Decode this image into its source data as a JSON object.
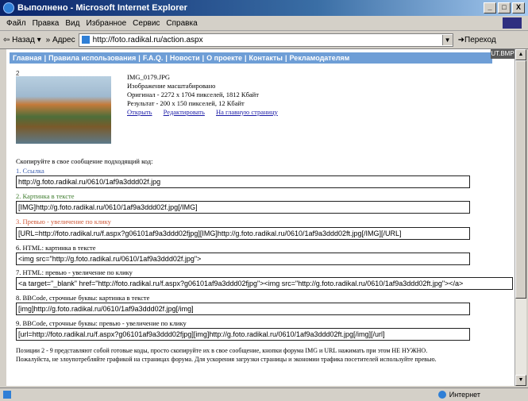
{
  "window": {
    "title": "Выполнено - Microsoft Internet Explorer",
    "minimize": "_",
    "maximize": "□",
    "close": "X"
  },
  "menu": {
    "items": [
      "Файл",
      "Правка",
      "Вид",
      "Избранное",
      "Сервис",
      "Справка"
    ]
  },
  "toolbar": {
    "back_label": "Назад",
    "address_label": "Адрес",
    "url": "http://foto.radikal.ru/action.aspx",
    "go_label": "Переход"
  },
  "nav": {
    "items": [
      "Главная",
      "Правила использования",
      "F.A.Q.",
      "Новости",
      "О проекте",
      "Контакты",
      "Рекламодателям"
    ],
    "separator": "|"
  },
  "image_info": {
    "marker": "2",
    "filename": "IMG_0179.JPG",
    "scaled_note": "Изображение масштабировано",
    "original": "Оригинал - 2272 x 1704 пикселей, 1812 Кбайт",
    "result": "Результат - 200 x 150 пикселей, 12 Кбайт",
    "links": [
      "Открыть",
      "Редактировать",
      "На главную страницу"
    ]
  },
  "copy_prompt": "Скопируйте в свое сообщение подходящий код:",
  "codes": [
    {
      "label": "1. Ссылка",
      "value": "http://g.foto.radikal.ru/0610/1af9a3ddd02f.jpg"
    },
    {
      "label": "2. Картинка в тексте",
      "value": "[IMG]http://g.foto.radikal.ru/0610/1af9a3ddd02f.jpg[/IMG]"
    },
    {
      "label": "3. Превью - увеличение по клику",
      "value": "[URL=http://foto.radikal.ru/f.aspx?g06101af9a3ddd02fjpg][IMG]http://g.foto.radikal.ru/0610/1af9a3ddd02ft.jpg[/IMG][/URL]"
    },
    {
      "label": "6. HTML: картинка в тексте",
      "value": "<img src=\"http://g.foto.radikal.ru/0610/1af9a3ddd02f.jpg\">"
    },
    {
      "label": "7. HTML: превью - увеличение по клику",
      "value": "<a target=\"_blank\" href=\"http://foto.radikal.ru/f.aspx?g06101af9a3ddd02fjpg\"><img src=\"http://g.foto.radikal.ru/0610/1af9a3ddd02ft.jpg\"></a>"
    },
    {
      "label": "8. BBCode, строчные буквы: картинка в тексте",
      "value": "[img]http://g.foto.radikal.ru/0610/1af9a3ddd02f.jpg[/img]"
    },
    {
      "label": "9. BBCode, строчные буквы: превью - увеличение по клику",
      "value": "[url=http://foto.radikal.ru/f.aspx?g06101af9a3ddd02fjpg][img]http://g.foto.radikal.ru/0610/1af9a3ddd02ft.jpg[/img][/url]"
    }
  ],
  "note": "Позиции 2 - 9 представляют собой готовые коды, просто скопируйте их в свое сообщение, кнопки форума IMG и URL нажимать при этом НЕ НУЖНО. Пожалуйста, не злоупотребляйте графикой на страницах форума. Для ускорения загрузки страницы и экономии трафика посетителей используйте превью.",
  "status": {
    "zone": "Интернет"
  },
  "corner_label": "UT.BMP"
}
